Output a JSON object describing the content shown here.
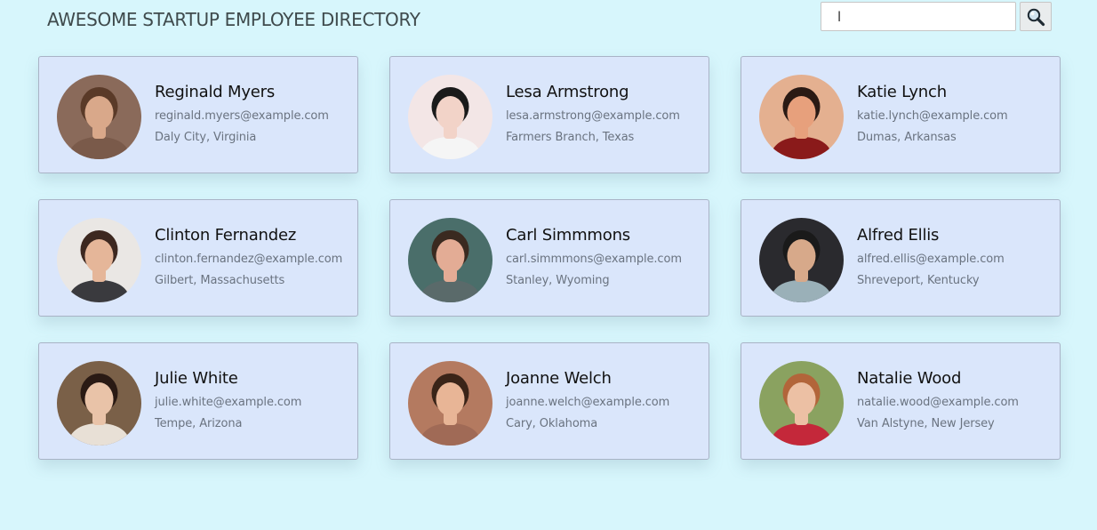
{
  "header": {
    "title": "AWESOME STARTUP EMPLOYEE DIRECTORY"
  },
  "search": {
    "value": "l",
    "button_icon": "magnifier-icon"
  },
  "employees": [
    {
      "name": "Reginald Myers",
      "email": "reginald.myers@example.com",
      "location": "Daly City, Virginia",
      "bg": "#8a6a5a",
      "skin": "#d9a88a",
      "hair": "#5a3a28",
      "shirt": "#7a5a4a"
    },
    {
      "name": "Lesa Armstrong",
      "email": "lesa.armstrong@example.com",
      "location": "Farmers Branch, Texas",
      "bg": "#f3e6e6",
      "skin": "#f2d3c8",
      "hair": "#1a1a1a",
      "shirt": "#f5f5f5"
    },
    {
      "name": "Katie Lynch",
      "email": "katie.lynch@example.com",
      "location": "Dumas, Arkansas",
      "bg": "#e4b090",
      "skin": "#e7a07c",
      "hair": "#2a1a14",
      "shirt": "#8a1a1a"
    },
    {
      "name": "Clinton Fernandez",
      "email": "clinton.fernandez@example.com",
      "location": "Gilbert, Massachusetts",
      "bg": "#eae7e4",
      "skin": "#e5b699",
      "hair": "#3d2820",
      "shirt": "#3a3a3e"
    },
    {
      "name": "Carl Simmmons",
      "email": "carl.simmmons@example.com",
      "location": "Stanley, Wyoming",
      "bg": "#4a6e6a",
      "skin": "#e3ac95",
      "hair": "#3a2a20",
      "shirt": "#5a6a6a"
    },
    {
      "name": "Alfred Ellis",
      "email": "alfred.ellis@example.com",
      "location": "Shreveport, Kentucky",
      "bg": "#2a2a2e",
      "skin": "#d7a98a",
      "hair": "#1a1a1a",
      "shirt": "#9ab0b8"
    },
    {
      "name": "Julie White",
      "email": "julie.white@example.com",
      "location": "Tempe, Arizona",
      "bg": "#7a6048",
      "skin": "#e9c3a8",
      "hair": "#2a1a14",
      "shirt": "#e8e0d6"
    },
    {
      "name": "Joanne Welch",
      "email": "joanne.welch@example.com",
      "location": "Cary, Oklahoma",
      "bg": "#b47a60",
      "skin": "#e8b596",
      "hair": "#3a2418",
      "shirt": "#a06a56"
    },
    {
      "name": "Natalie Wood",
      "email": "natalie.wood@example.com",
      "location": "Van Alstyne, New Jersey",
      "bg": "#8aa260",
      "skin": "#ecc0a4",
      "hair": "#b2653a",
      "shirt": "#c4283a"
    }
  ]
}
